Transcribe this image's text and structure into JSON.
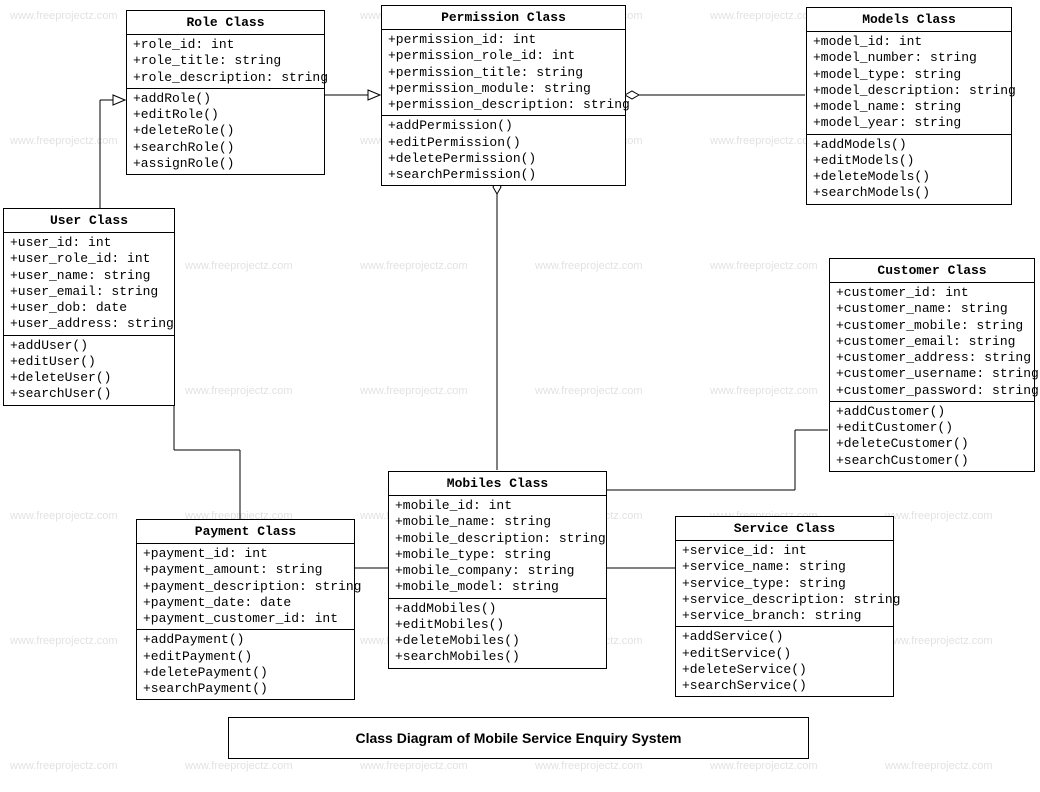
{
  "title": "Class Diagram of Mobile Service Enquiry System",
  "watermark_text": "www.freeprojectz.com",
  "classes": {
    "role": {
      "name": "Role Class",
      "attributes": [
        "+role_id: int",
        "+role_title: string",
        "+role_description: string"
      ],
      "methods": [
        "+addRole()",
        "+editRole()",
        "+deleteRole()",
        "+searchRole()",
        "+assignRole()"
      ]
    },
    "permission": {
      "name": "Permission Class",
      "attributes": [
        "+permission_id: int",
        "+permission_role_id: int",
        "+permission_title: string",
        "+permission_module: string",
        "+permission_description: string"
      ],
      "methods": [
        "+addPermission()",
        "+editPermission()",
        "+deletePermission()",
        "+searchPermission()"
      ]
    },
    "models": {
      "name": "Models Class",
      "attributes": [
        "+model_id: int",
        "+model_number: string",
        "+model_type: string",
        "+model_description: string",
        "+model_name: string",
        "+model_year: string"
      ],
      "methods": [
        "+addModels()",
        "+editModels()",
        "+deleteModels()",
        "+searchModels()"
      ]
    },
    "user": {
      "name": "User Class",
      "attributes": [
        "+user_id: int",
        "+user_role_id: int",
        "+user_name: string",
        "+user_email: string",
        "+user_dob: date",
        "+user_address: string"
      ],
      "methods": [
        "+addUser()",
        "+editUser()",
        "+deleteUser()",
        "+searchUser()"
      ]
    },
    "customer": {
      "name": "Customer Class",
      "attributes": [
        "+customer_id: int",
        "+customer_name: string",
        "+customer_mobile: string",
        "+customer_email: string",
        "+customer_address: string",
        "+customer_username: string",
        "+customer_password: string"
      ],
      "methods": [
        "+addCustomer()",
        "+editCustomer()",
        "+deleteCustomer()",
        "+searchCustomer()"
      ]
    },
    "payment": {
      "name": "Payment Class",
      "attributes": [
        "+payment_id: int",
        "+payment_amount: string",
        "+payment_description: string",
        "+payment_date: date",
        "+payment_customer_id: int"
      ],
      "methods": [
        "+addPayment()",
        "+editPayment()",
        "+deletePayment()",
        "+searchPayment()"
      ]
    },
    "mobiles": {
      "name": "Mobiles  Class",
      "attributes": [
        "+mobile_id: int",
        "+mobile_name: string",
        "+mobile_description: string",
        "+mobile_type: string",
        "+mobile_company: string",
        "+mobile_model: string"
      ],
      "methods": [
        "+addMobiles()",
        "+editMobiles()",
        "+deleteMobiles()",
        "+searchMobiles()"
      ]
    },
    "service": {
      "name": "Service Class",
      "attributes": [
        "+service_id: int",
        "+service_name: string",
        "+service_type: string",
        "+service_description: string",
        "+service_branch: string"
      ],
      "methods": [
        "+addService()",
        "+editService()",
        "+deleteService()",
        "+searchService()"
      ]
    }
  }
}
